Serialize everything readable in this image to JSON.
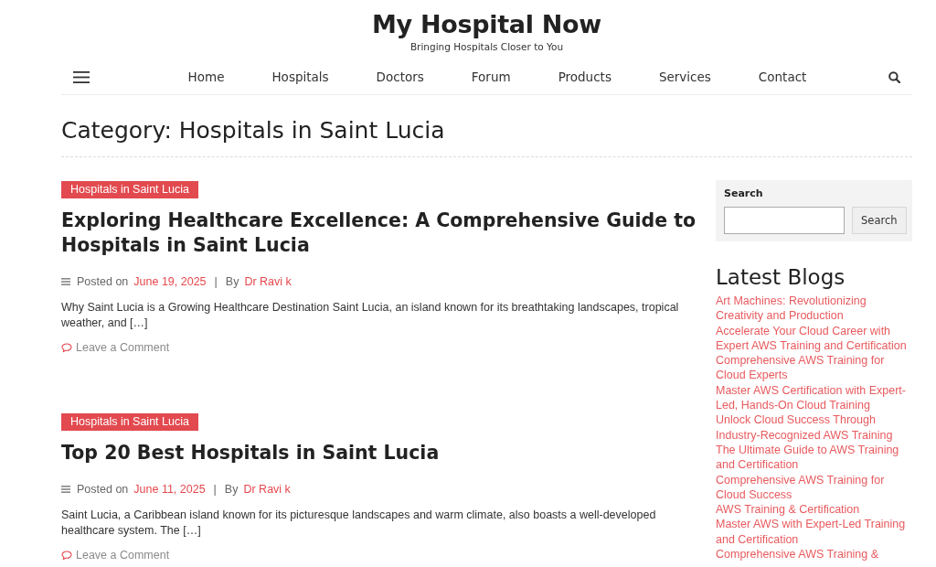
{
  "header": {
    "site_title": "My Hospital Now",
    "tagline": "Bringing Hospitals Closer to You"
  },
  "nav": {
    "items": [
      "Home",
      "Hospitals",
      "Doctors",
      "Forum",
      "Products",
      "Services",
      "Contact"
    ]
  },
  "category_title": "Category: Hospitals in Saint Lucia",
  "posts": [
    {
      "category": "Hospitals in Saint Lucia",
      "title": "Exploring Healthcare Excellence: A Comprehensive Guide to Hospitals in Saint Lucia",
      "posted_label": "Posted on",
      "date": "June 19, 2025",
      "separator": "|",
      "by_label": "By",
      "author": "Dr Ravi k",
      "excerpt": "Why Saint Lucia is a Growing Healthcare Destination Saint Lucia, an island known for its breathtaking landscapes, tropical weather, and […]",
      "comment_link": "Leave a Comment"
    },
    {
      "category": "Hospitals in Saint Lucia",
      "title": "Top 20 Best Hospitals in Saint Lucia",
      "posted_label": "Posted on",
      "date": "June 11, 2025",
      "separator": "|",
      "by_label": "By",
      "author": "Dr Ravi k",
      "excerpt": "Saint Lucia, a Caribbean island known for its picturesque landscapes and warm climate, also boasts a well-developed healthcare system. The […]",
      "comment_link": "Leave a Comment"
    }
  ],
  "sidebar": {
    "search": {
      "label": "Search",
      "button": "Search"
    },
    "latest_blogs": {
      "title": "Latest Blogs",
      "links": [
        "Art Machines: Revolutionizing Creativity and Production",
        "Accelerate Your Cloud Career with Expert AWS Training and Certification",
        "Comprehensive AWS Training for Cloud Experts",
        "Master AWS Certification with Expert-Led, Hands-On Cloud Training",
        "Unlock Cloud Success Through Industry-Recognized AWS Training",
        "The Ultimate Guide to AWS Training and Certification",
        "Comprehensive AWS Training for Cloud Success",
        "AWS Training & Certification",
        "Master AWS with Expert-Led Training and Certification",
        "Comprehensive AWS Training &"
      ]
    }
  }
}
